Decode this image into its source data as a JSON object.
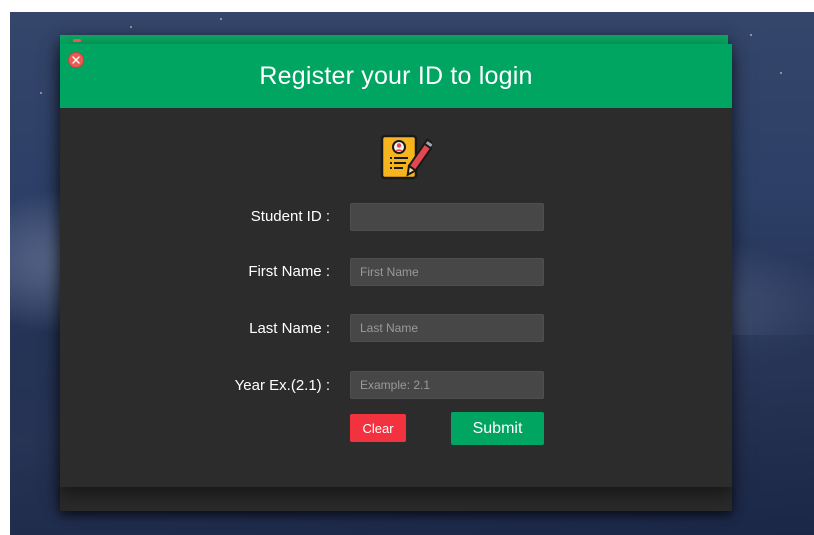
{
  "window": {
    "title": "Register your ID to login"
  },
  "form": {
    "student_id": {
      "label": "Student ID :",
      "value": "",
      "placeholder": ""
    },
    "first_name": {
      "label": "First Name :",
      "value": "",
      "placeholder": "First Name"
    },
    "last_name": {
      "label": "Last Name :",
      "value": "",
      "placeholder": "Last Name"
    },
    "year": {
      "label": "Year Ex.(2.1) :",
      "value": "",
      "placeholder": "Example: 2.1"
    }
  },
  "buttons": {
    "clear_label": "Clear",
    "submit_label": "Submit"
  },
  "icons": {
    "close": "close-icon",
    "logo": "registration-form-icon"
  },
  "colors": {
    "header": "#00a562",
    "window_bg": "#2c2c2c",
    "input_bg": "#474747",
    "clear_button": "#f2323f",
    "submit_button": "#00a562",
    "close_button": "#ec5a52"
  }
}
